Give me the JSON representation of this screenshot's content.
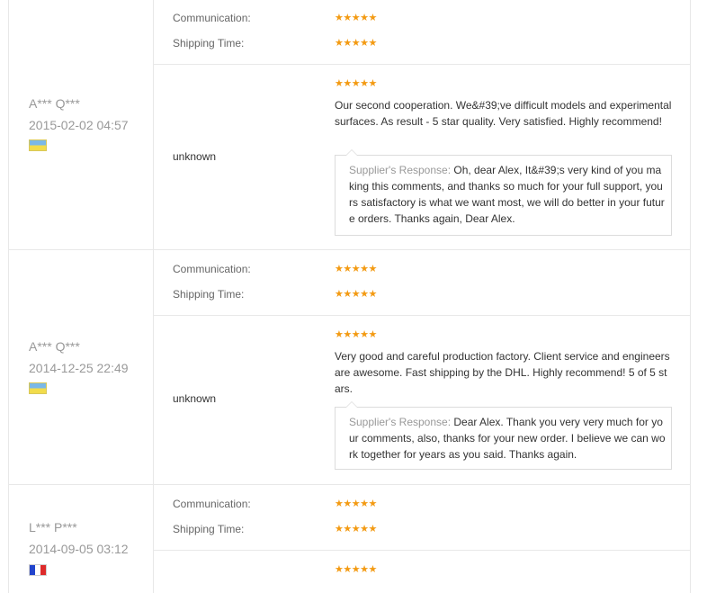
{
  "ratings": {
    "communication_label": "Communication:",
    "shipping_label": "Shipping Time:",
    "stars": "★★★★★"
  },
  "feedback": [
    {
      "buyer": "",
      "date": "",
      "flag": "",
      "communication_rating": 5,
      "shipping_rating": 5
    },
    {
      "buyer": "A*** Q***",
      "date": "2015-02-02 04:57",
      "flag": "ua-flag-icon",
      "product": "unknown",
      "rating": 5,
      "comment": "Our second cooperation. We&#39;ve difficult models and experimental surfaces. As result - 5 star quality. Very satisfied. Highly recommend!",
      "response_label": "Supplier's Response:",
      "response": "Oh, dear Alex, It&#39;s very kind of you making this comments, and thanks so much for your full support, yours satisfactory is what we want most, we will do better in your future orders. Thanks again, Dear Alex."
    },
    {
      "buyer": "A*** Q***",
      "date": "2014-12-25 22:49",
      "flag": "ua-flag-icon",
      "communication_rating": 5,
      "shipping_rating": 5,
      "product": "unknown",
      "rating": 5,
      "comment": "Very good and careful production factory. Client service and engineers are awesome. Fast shipping by the DHL. Highly recommend! 5 of 5 stars.",
      "response_label": "Supplier's Response:",
      "response": "Dear Alex. Thank you very very much for your comments, also, thanks for your new order. I believe we can work together for years as you said. Thanks again."
    },
    {
      "buyer": "L*** P***",
      "date": "2014-09-05 03:12",
      "flag": "fr-flag-icon",
      "communication_rating": 5,
      "shipping_rating": 5,
      "rating": 5
    }
  ]
}
